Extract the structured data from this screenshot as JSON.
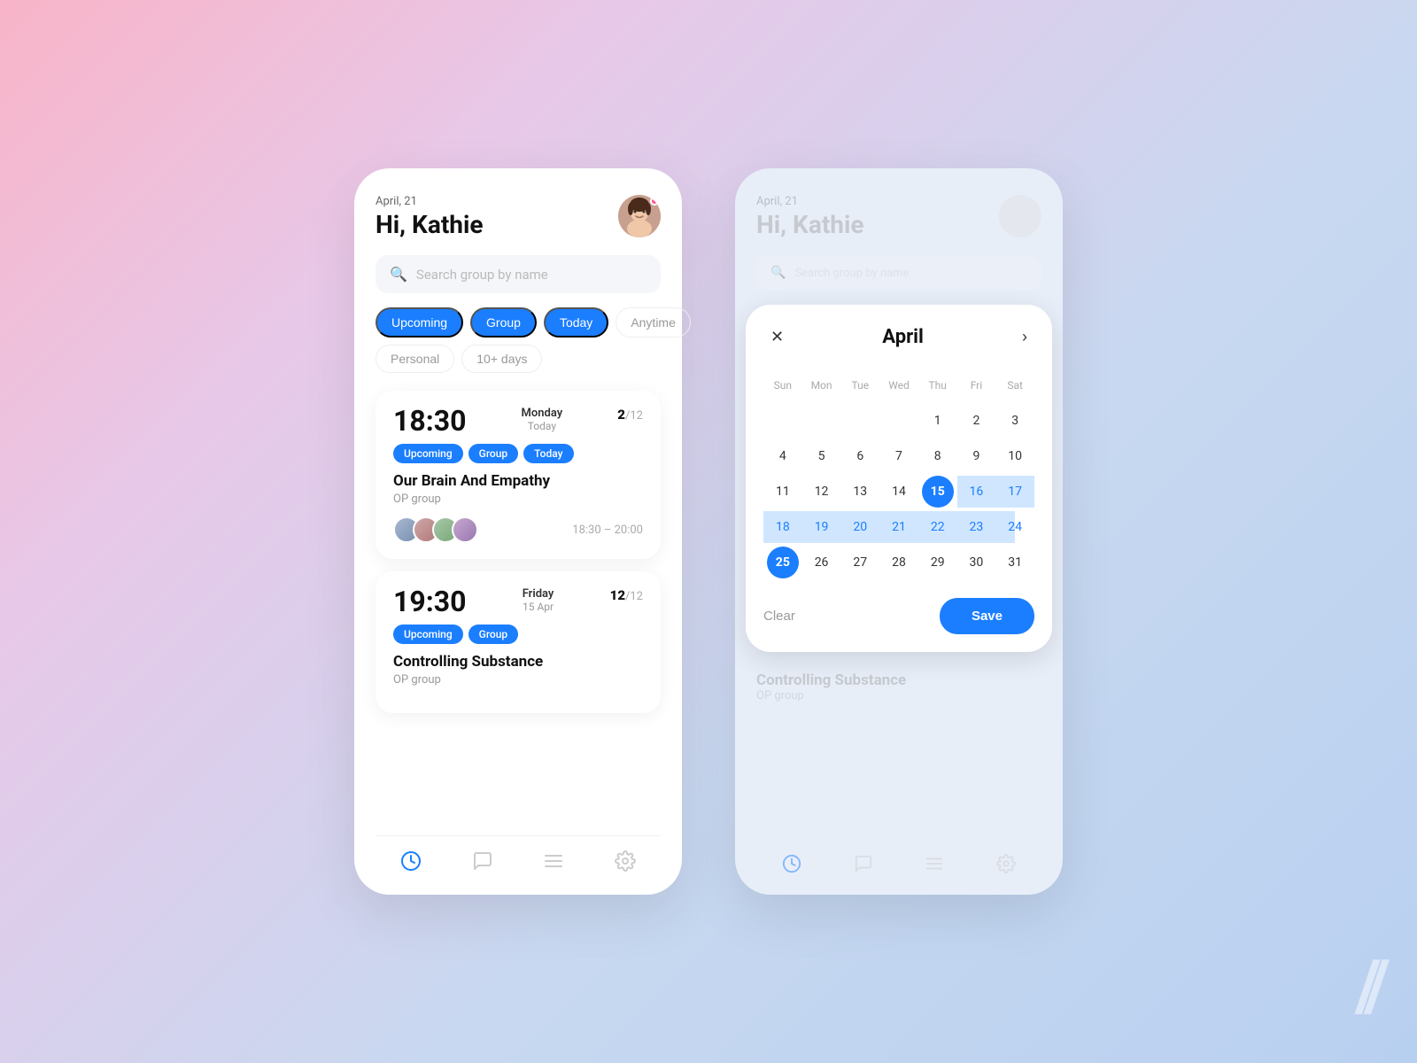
{
  "page": {
    "background": "gradient pink-blue"
  },
  "phone1": {
    "date_label": "April, 21",
    "greeting": "Hi, Kathie",
    "search_placeholder": "Search group by name",
    "filters_row1": [
      "Upcoming",
      "Group",
      "Today",
      "Anytime"
    ],
    "filters_row2": [
      "Personal",
      "10+ days"
    ],
    "active_filters": [
      "Upcoming",
      "Group",
      "Today"
    ],
    "sessions": [
      {
        "time": "18:30",
        "day": "Monday",
        "date": "Today",
        "count": "2",
        "total": "12",
        "tags": [
          "Upcoming",
          "Group",
          "Today"
        ],
        "title": "Our Brain And Empathy",
        "group": "OP group",
        "time_range": "18:30 – 20:00",
        "has_avatars": true
      },
      {
        "time": "19:30",
        "day": "Friday",
        "date": "15 Apr",
        "count": "12",
        "total": "12",
        "tags": [
          "Upcoming",
          "Group"
        ],
        "title": "Controlling Substance",
        "group": "OP group",
        "time_range": "",
        "has_avatars": false
      }
    ],
    "nav_items": [
      "clock",
      "chat",
      "menu",
      "settings"
    ]
  },
  "phone2": {
    "date_label": "April, 21",
    "greeting": "Hi, Kathie",
    "search_placeholder": "Search group by name",
    "calendar": {
      "month": "April",
      "day_labels": [
        "Sun",
        "Mon",
        "Tue",
        "Wed",
        "Thu",
        "Fri",
        "Sat"
      ],
      "weeks": [
        [
          "",
          "",
          "",
          "",
          "1",
          "2",
          "3",
          "4"
        ],
        [
          "5",
          "6",
          "7",
          "8",
          "9",
          "10",
          "11"
        ],
        [
          "12",
          "13",
          "14",
          "15",
          "16",
          "17",
          "18"
        ],
        [
          "19",
          "20",
          "21",
          "22",
          "23",
          "24",
          "25"
        ],
        [
          "26",
          "27",
          "28",
          "29",
          "30",
          "31",
          ""
        ]
      ],
      "selected_start": "15",
      "selected_end": "25",
      "range": [
        "16",
        "17",
        "18",
        "19",
        "20",
        "21",
        "22",
        "23",
        "24"
      ]
    },
    "clear_label": "Clear",
    "save_label": "Save",
    "bottom_session_title": "Controlling Substance",
    "bottom_session_group": "OP group"
  },
  "deco": "//"
}
